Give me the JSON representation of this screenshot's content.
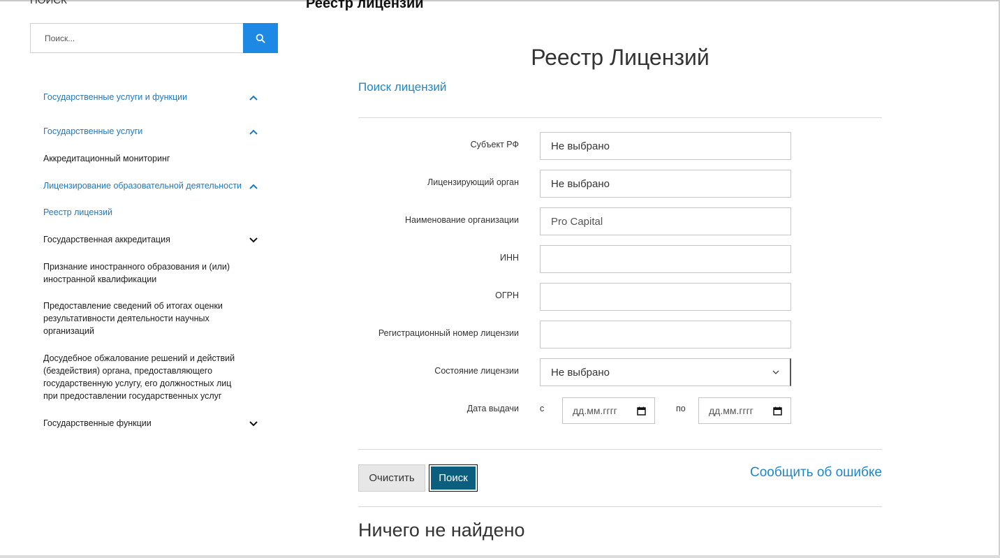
{
  "sidebar": {
    "title": "ПОИСК",
    "search_placeholder": "Поиск...",
    "items": [
      {
        "label": "Государственные услуги и функции",
        "style": "link",
        "chevron": "up"
      },
      {
        "label": "Государственные услуги",
        "style": "link",
        "chevron": "up"
      },
      {
        "label": "Аккредитационный мониторинг",
        "style": "plain",
        "chevron": ""
      },
      {
        "label": "Лицензирование образовательной деятельности",
        "style": "link",
        "chevron": "up"
      },
      {
        "label": "Реестр лицензий",
        "style": "link",
        "chevron": ""
      },
      {
        "label": "Государственная аккредитация",
        "style": "plain",
        "chevron": "down"
      },
      {
        "label": "Признание иностранного образования и (или) иностранной квалификации",
        "style": "plain",
        "chevron": ""
      },
      {
        "label": "Предоставление сведений об итогах оценки результативности деятельности научных организаций",
        "style": "plain",
        "chevron": ""
      },
      {
        "label": "Досудебное обжалование решений и действий (бездействия) органа, предоставляющего государственную услугу, его должностных лиц при предоставлении государственных услуг",
        "style": "plain",
        "chevron": ""
      },
      {
        "label": "Государственные функции",
        "style": "plain",
        "chevron": "down"
      }
    ]
  },
  "page": {
    "heading": "Реестр лицензий",
    "main_title": "Реестр Лицензий",
    "section_link": "Поиск лицензий"
  },
  "form": {
    "subject": {
      "label": "Субъект РФ",
      "value": "Не выбрано"
    },
    "licensing_body": {
      "label": "Лицензирующий орган",
      "value": "Не выбрано"
    },
    "org_name": {
      "label": "Наименование организации",
      "value": "Pro Capital"
    },
    "inn": {
      "label": "ИНН",
      "value": ""
    },
    "ogrn": {
      "label": "ОГРН",
      "value": ""
    },
    "reg_number": {
      "label": "Регистрационный номер лицензии",
      "value": ""
    },
    "status": {
      "label": "Состояние лицензии",
      "value": "Не выбрано"
    },
    "issue_date": {
      "label": "Дата выдачи",
      "from_label": "с",
      "to_label": "по",
      "from_placeholder": "дд.мм.гггг",
      "to_placeholder": "дд.мм.гггг"
    }
  },
  "actions": {
    "clear": "Очистить",
    "search": "Поиск",
    "report_error": "Сообщить об ошибке"
  },
  "results": {
    "message": "Ничего не найдено"
  },
  "colors": {
    "link": "#1f78c1",
    "search_button": "#1e88e5",
    "primary_button": "#0b5e7d"
  }
}
